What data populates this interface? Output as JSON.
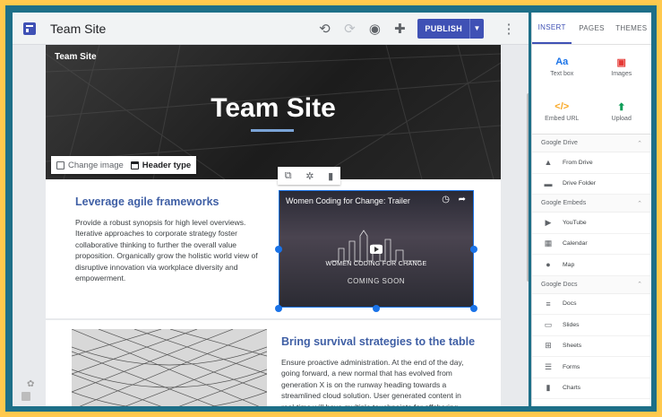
{
  "toolbar": {
    "site_title": "Team Site",
    "publish_label": "PUBLISH"
  },
  "hero": {
    "brand": "Team Site",
    "title": "Team Site",
    "change_image": "Change image",
    "header_type": "Header type"
  },
  "section1": {
    "heading": "Leverage agile frameworks",
    "body": "Provide a robust synopsis for high level overviews. Iterative approaches to corporate strategy foster collaborative thinking to further the overall value proposition. Organically grow the holistic world view of disruptive innovation via workplace diversity and empowerment."
  },
  "video": {
    "title": "Women Coding for Change: Trailer",
    "banner": "WOMEN CODING FOR CHANGE",
    "coming": "COMING SOON"
  },
  "section2": {
    "heading": "Bring survival strategies to the table",
    "body": "Ensure proactive administration. At the end of the day, going forward, a new normal that has evolved from generation X is on the runway heading towards a streamlined cloud solution. User generated content in real-time will have multiple touchpoints for offshoring."
  },
  "panel": {
    "tabs": [
      "INSERT",
      "PAGES",
      "THEMES"
    ],
    "insert": [
      {
        "icon": "Aa",
        "label": "Text box",
        "color": "#1a73e8"
      },
      {
        "icon": "▣",
        "label": "Images",
        "color": "#e53935"
      },
      {
        "icon": "</>",
        "label": "Embed URL",
        "color": "#f9a825"
      },
      {
        "icon": "⬆",
        "label": "Upload",
        "color": "#0f9d58"
      }
    ],
    "groups": [
      {
        "title": "Google Drive",
        "items": [
          {
            "icon": "▲",
            "label": "From Drive"
          },
          {
            "icon": "▬",
            "label": "Drive Folder"
          }
        ]
      },
      {
        "title": "Google Embeds",
        "items": [
          {
            "icon": "▶",
            "label": "YouTube"
          },
          {
            "icon": "▦",
            "label": "Calendar"
          },
          {
            "icon": "●",
            "label": "Map"
          }
        ]
      },
      {
        "title": "Google Docs",
        "items": [
          {
            "icon": "≡",
            "label": "Docs"
          },
          {
            "icon": "▭",
            "label": "Slides"
          },
          {
            "icon": "⊞",
            "label": "Sheets"
          },
          {
            "icon": "☰",
            "label": "Forms"
          },
          {
            "icon": "▮",
            "label": "Charts"
          }
        ]
      }
    ]
  }
}
